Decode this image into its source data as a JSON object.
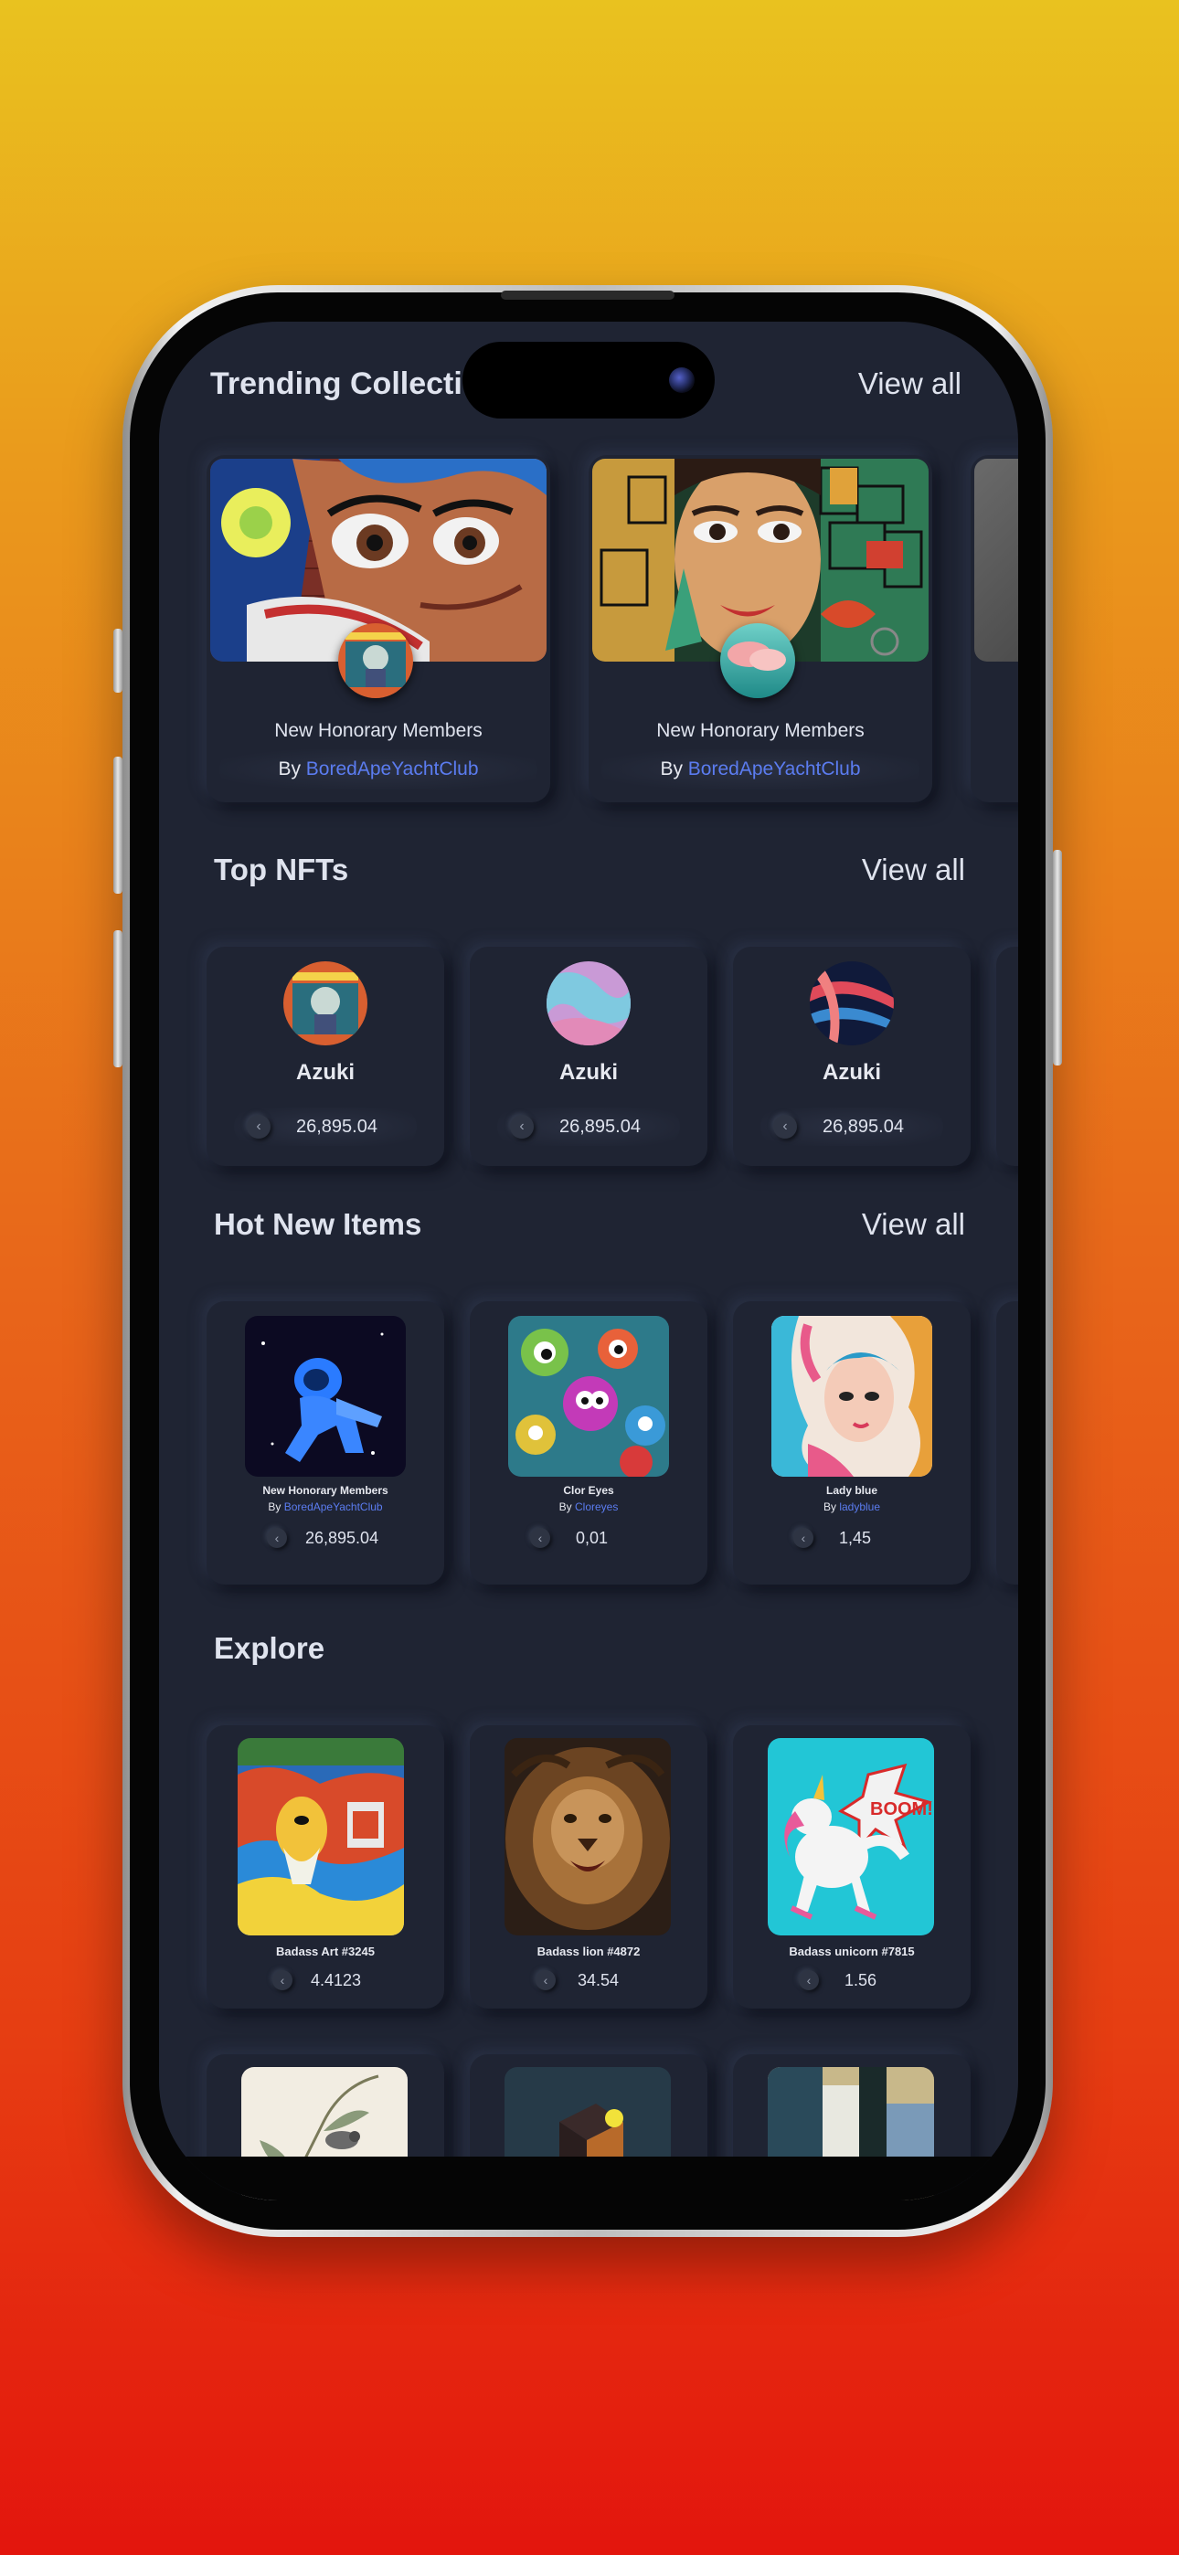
{
  "trending": {
    "title": "Trending Collection",
    "view_all": "View all",
    "cards": [
      {
        "name": "New Honorary Members",
        "by": "By ",
        "creator": "BoredApeYachtClub"
      },
      {
        "name": "New Honorary Members",
        "by": "By ",
        "creator": "BoredApeYachtClub"
      }
    ]
  },
  "top_nfts": {
    "title": "Top NFTs",
    "view_all": "View all",
    "items": [
      {
        "name": "Azuki",
        "price": "26,895.04"
      },
      {
        "name": "Azuki",
        "price": "26,895.04"
      },
      {
        "name": "Azuki",
        "price": "26,895.04"
      }
    ]
  },
  "hot_new": {
    "title": "Hot New Items",
    "view_all": "View all",
    "items": [
      {
        "name": "New Honorary Members",
        "by": "By ",
        "creator": "BoredApeYachtClub",
        "price": "26,895.04"
      },
      {
        "name": "Clor Eyes",
        "by": "By ",
        "creator": "Cloreyes",
        "price": "0,01"
      },
      {
        "name": "Lady blue",
        "by": "By ",
        "creator": "ladyblue",
        "price": "1,45"
      }
    ]
  },
  "explore": {
    "title": "Explore",
    "items": [
      {
        "name": "Badass Art #3245",
        "price": "4.4123"
      },
      {
        "name": "Badass lion #4872",
        "price": "34.54"
      },
      {
        "name": "Badass unicorn #7815",
        "price": "1.56"
      }
    ]
  },
  "icons": {
    "currency": "ethereum-icon"
  },
  "colors": {
    "background": "#1f2433",
    "accent_link": "#5b7cf0",
    "text": "#dfe3ee"
  }
}
